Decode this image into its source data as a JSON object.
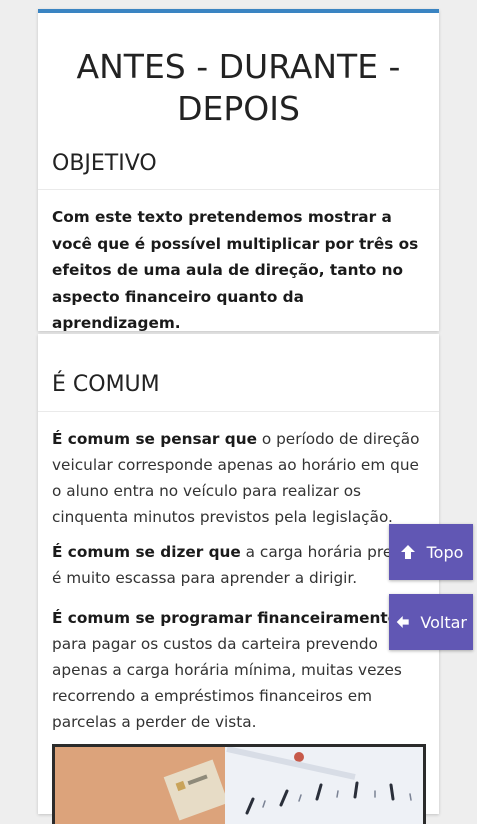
{
  "header": {
    "title": "ANTES - DURANTE - DEPOIS"
  },
  "objective": {
    "heading": "OBJETIVO",
    "text": "Com este texto pretendemos mostrar a você que é possível multiplicar por três os efeitos de uma aula de direção, tanto no aspecto financeiro quanto da aprendizagem."
  },
  "section": {
    "heading": "É COMUM",
    "paragraphs": [
      {
        "bold": "É comum se pensar que",
        "text": " o período de direção veicular corresponde apenas ao horário em que o aluno entra no veículo para realizar os cinquenta minutos previstos pela legislação."
      },
      {
        "bold": "É comum se dizer que",
        "text": " a carga horária prevista é muito escassa para aprender a dirigir."
      },
      {
        "bold": "É comum se programar financeiramente",
        "text": " para pagar os custos da carteira prevendo apenas a carga horária mínima, muitas vezes recorrendo a empréstimos financeiros em parcelas a perder de vista."
      }
    ]
  },
  "floating_buttons": {
    "top_label": "Topo",
    "back_label": "Voltar"
  },
  "colors": {
    "accent_border": "#3a84c2",
    "floating_button_bg": "#6157b4"
  },
  "icons": {
    "top": "arrow-up-icon",
    "back": "arrow-left-icon"
  }
}
